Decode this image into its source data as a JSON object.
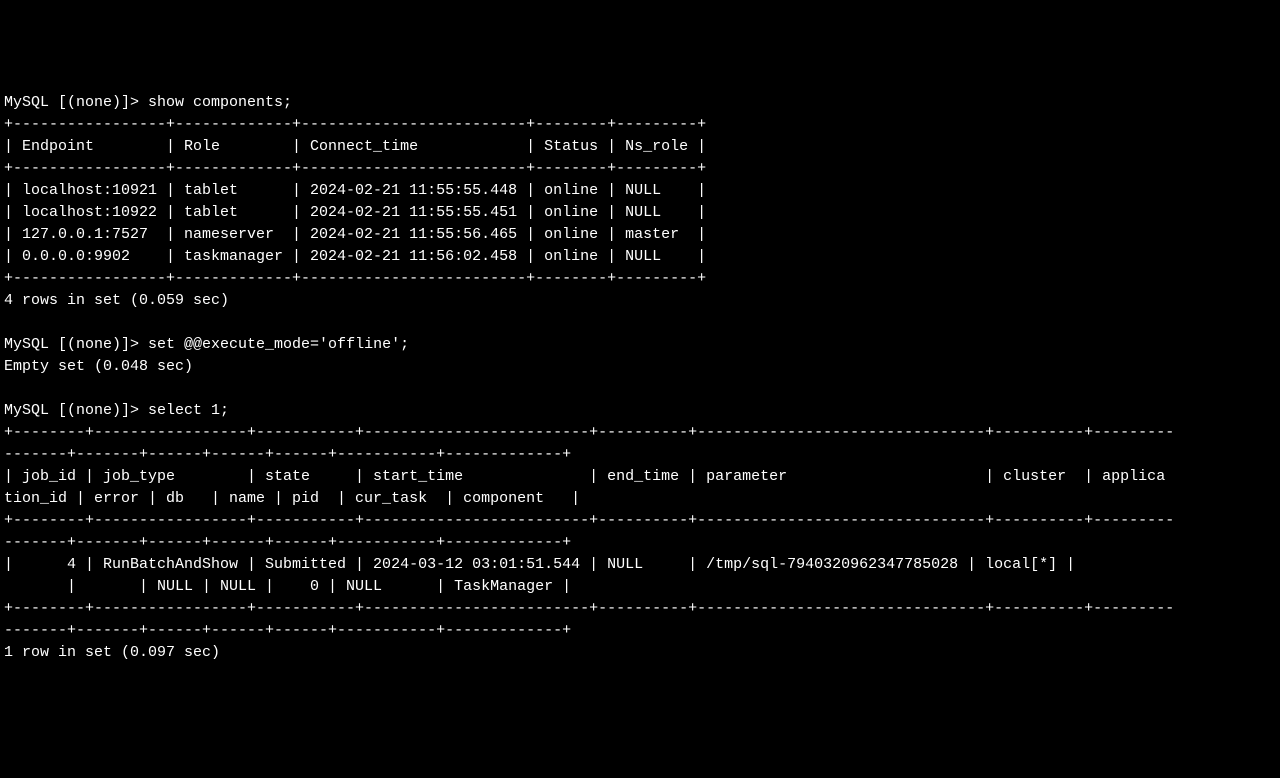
{
  "prompt_prefix": "MySQL [(none)]> ",
  "query1": {
    "command": "show components;",
    "top_sep": "+-----------------+-------------+-------------------------+--------+---------+",
    "header_row": "| Endpoint        | Role        | Connect_time            | Status | Ns_role |",
    "mid_sep": "+-----------------+-------------+-------------------------+--------+---------+",
    "row1": "| localhost:10921 | tablet      | 2024-02-21 11:55:55.448 | online | NULL    |",
    "row2": "| localhost:10922 | tablet      | 2024-02-21 11:55:55.451 | online | NULL    |",
    "row3": "| 127.0.0.1:7527  | nameserver  | 2024-02-21 11:55:56.465 | online | master  |",
    "row4": "| 0.0.0.0:9902    | taskmanager | 2024-02-21 11:56:02.458 | online | NULL    |",
    "bot_sep": "+-----------------+-------------+-------------------------+--------+---------+",
    "summary": "4 rows in set (0.059 sec)"
  },
  "query2": {
    "command": "set @@execute_mode='offline';",
    "summary": "Empty set (0.048 sec)"
  },
  "query3": {
    "command": "select 1;",
    "sep_line1": "+--------+-----------------+-----------+-------------------------+----------+--------------------------------+----------+---------",
    "sep_line2": "-------+-------+------+------+------+-----------+-------------+",
    "hdr_line1": "| job_id | job_type        | state     | start_time              | end_time | parameter                      | cluster  | applica",
    "hdr_line2": "tion_id | error | db   | name | pid  | cur_task  | component   |",
    "mid_line1": "+--------+-----------------+-----------+-------------------------+----------+--------------------------------+----------+---------",
    "mid_line2": "-------+-------+------+------+------+-----------+-------------+",
    "row_line1": "|      4 | RunBatchAndShow | Submitted | 2024-03-12 03:01:51.544 | NULL     | /tmp/sql-7940320962347785028 | local[*] |        ",
    "row_line2": "       |       | NULL | NULL |    0 | NULL      | TaskManager |",
    "bot_line1": "+--------+-----------------+-----------+-------------------------+----------+--------------------------------+----------+---------",
    "bot_line2": "-------+-------+------+------+------+-----------+-------------+",
    "summary": "1 row in set (0.097 sec)"
  }
}
